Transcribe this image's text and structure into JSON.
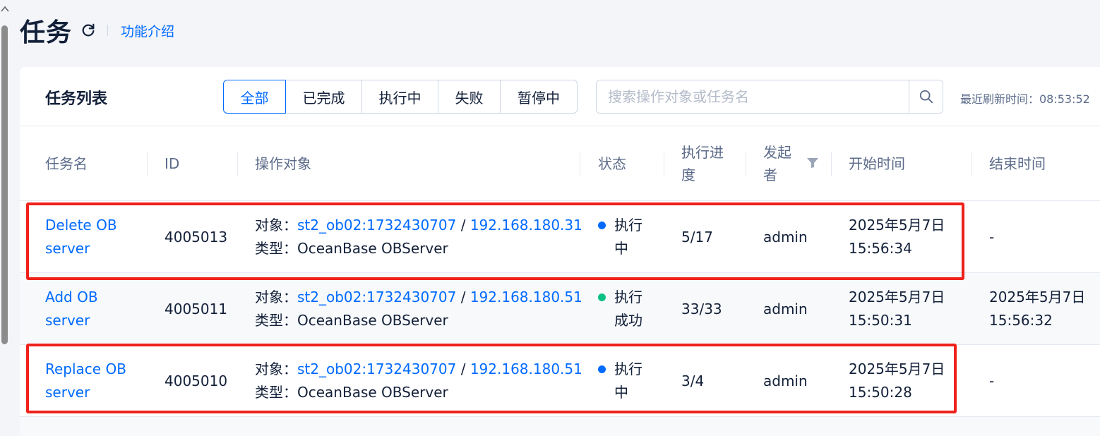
{
  "page": {
    "title": "任务",
    "intro_link": "功能介绍"
  },
  "card": {
    "title": "任务列表",
    "filters": [
      "全部",
      "已完成",
      "执行中",
      "失败",
      "暂停中"
    ],
    "active_filter": "全部",
    "search_placeholder": "搜索操作对象或任务名",
    "refresh_label": "最近刷新时间：08:53:52"
  },
  "table": {
    "columns": {
      "name": "任务名",
      "id": "ID",
      "target": "操作对象",
      "status": "状态",
      "progress_1": "执行进",
      "progress_2": "度",
      "initiator_1": "发起",
      "initiator_2": "者",
      "start_time": "开始时间",
      "end_time": "结束时间"
    },
    "rows": [
      {
        "name_1": "Delete OB",
        "name_2": "server",
        "id": "4005013",
        "target_label": "对象：",
        "target_host": "st2_ob02:1732430707",
        "target_sep": " / ",
        "target_ip": "192.168.180.31",
        "type_label": "类型：",
        "type_value": "OceanBase OBServer",
        "status_1": "执行",
        "status_2": "中",
        "status_color": "#006aff",
        "progress": "5/17",
        "initiator": "admin",
        "start_1": "2025年5月7日",
        "start_2": "15:56:34",
        "end_1": "-",
        "end_2": "",
        "highlighted": true
      },
      {
        "name_1": "Add OB",
        "name_2": "server",
        "id": "4005011",
        "target_label": "对象：",
        "target_host": "st2_ob02:1732430707",
        "target_sep": " / ",
        "target_ip": "192.168.180.51",
        "type_label": "类型：",
        "type_value": "OceanBase OBServer",
        "status_1": "执行",
        "status_2": "成功",
        "status_color": "#0ac185",
        "progress": "33/33",
        "initiator": "admin",
        "start_1": "2025年5月7日",
        "start_2": "15:50:31",
        "end_1": "2025年5月7日",
        "end_2": "15:56:32",
        "highlighted": false
      },
      {
        "name_1": "Replace OB",
        "name_2": "server",
        "id": "4005010",
        "target_label": "对象：",
        "target_host": "st2_ob02:1732430707",
        "target_sep": " / ",
        "target_ip": "192.168.180.51",
        "type_label": "类型：",
        "type_value": "OceanBase OBServer",
        "status_1": "执行",
        "status_2": "中",
        "status_color": "#006aff",
        "progress": "3/4",
        "initiator": "admin",
        "start_1": "2025年5月7日",
        "start_2": "15:50:28",
        "end_1": "-",
        "end_2": "",
        "highlighted": true
      }
    ]
  },
  "colors": {
    "accent": "#006aff",
    "success": "#0ac185",
    "highlight_border": "#f0211b"
  },
  "icons": [
    "refresh-icon",
    "search-icon",
    "filter-icon",
    "scroll-up-arrow-icon"
  ]
}
